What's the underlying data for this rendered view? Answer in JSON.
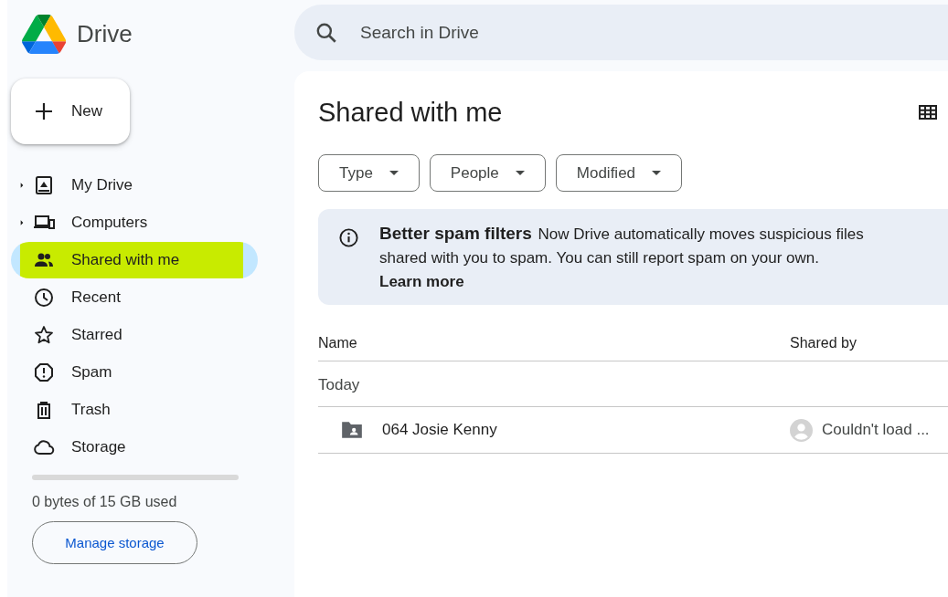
{
  "app": {
    "name": "Drive"
  },
  "search": {
    "placeholder": "Search in Drive"
  },
  "new_button": {
    "label": "New"
  },
  "sidebar": {
    "items": [
      {
        "label": "My Drive",
        "expandable": true,
        "selected": false,
        "highlighted": false
      },
      {
        "label": "Computers",
        "expandable": true,
        "selected": false,
        "highlighted": false
      },
      {
        "label": "Shared with me",
        "expandable": false,
        "selected": true,
        "highlighted": true
      },
      {
        "label": "Recent",
        "expandable": false,
        "selected": false,
        "highlighted": false
      },
      {
        "label": "Starred",
        "expandable": false,
        "selected": false,
        "highlighted": false
      },
      {
        "label": "Spam",
        "expandable": false,
        "selected": false,
        "highlighted": false
      },
      {
        "label": "Trash",
        "expandable": false,
        "selected": false,
        "highlighted": false
      },
      {
        "label": "Storage",
        "expandable": false,
        "selected": false,
        "highlighted": false
      }
    ]
  },
  "storage": {
    "level": 0,
    "usage": "0 bytes of 15 GB used",
    "button": "Manage storage"
  },
  "page": {
    "title": "Shared with me"
  },
  "filters": [
    "Type",
    "People",
    "Modified"
  ],
  "banner": {
    "title": "Better spam filters",
    "text": "Now Drive automatically moves suspicious files shared with you to spam. You can still report spam on your own.",
    "link": "Learn more"
  },
  "table": {
    "columns": [
      "Name",
      "Shared by"
    ],
    "groups": [
      {
        "label": "Today",
        "rows": [
          {
            "name": "064 Josie Kenny",
            "shared_by": "Couldn't load ..."
          }
        ]
      }
    ]
  }
}
